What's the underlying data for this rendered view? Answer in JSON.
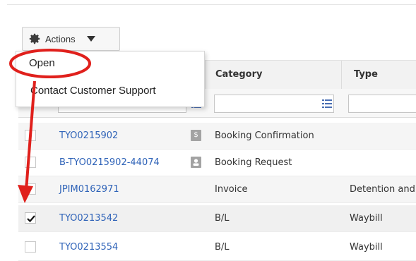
{
  "toolbar": {
    "actions_label": "Actions",
    "gear_icon": "gear-icon",
    "caret_icon": "caret-down-icon"
  },
  "menu": {
    "items": [
      {
        "label": "Open"
      },
      {
        "label": "Contact Customer Support"
      }
    ]
  },
  "table": {
    "columns": [
      "Category",
      "Type"
    ],
    "rows": [
      {
        "reference": "TYO0215902",
        "badge": "$",
        "badge_icon": "dollar-icon",
        "category": "Booking Confirmation",
        "type": "",
        "checked": false
      },
      {
        "reference": "B-TYO0215902-44074",
        "badge": "",
        "badge_icon": "user-icon",
        "category": "Booking Request",
        "type": "",
        "checked": false
      },
      {
        "reference": "JPIM0162971",
        "badge": "",
        "badge_icon": "",
        "category": "Invoice",
        "type": "Detention and",
        "checked": false
      },
      {
        "reference": "TYO0213542",
        "badge": "",
        "badge_icon": "",
        "category": "B/L",
        "type": "Waybill",
        "checked": true
      },
      {
        "reference": "TYO0213554",
        "badge": "",
        "badge_icon": "",
        "category": "B/L",
        "type": "Waybill",
        "checked": false
      }
    ]
  },
  "annotation": {
    "color": "#e0201c"
  }
}
